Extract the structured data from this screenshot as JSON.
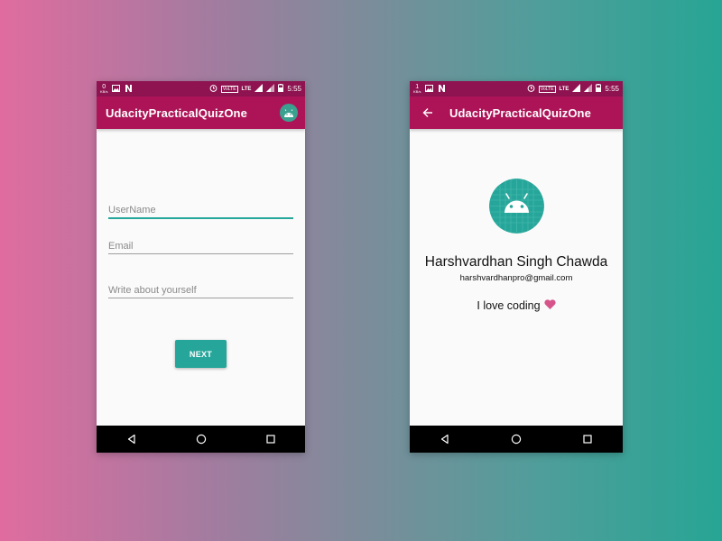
{
  "colors": {
    "primary": "#ad1457",
    "primary_dark": "#8e1350",
    "accent": "#26a69a",
    "heart": "#d6548a"
  },
  "screen1": {
    "status": {
      "kb_value": "0",
      "kb_unit": "KB/s",
      "volte": "VoLTE",
      "lte": "LTE",
      "time": "5:55"
    },
    "app_title": "UdacityPracticalQuizOne",
    "fields": {
      "username_placeholder": "UserName",
      "email_placeholder": "Email",
      "about_placeholder": "Write about yourself"
    },
    "next_label": "NEXT"
  },
  "screen2": {
    "status": {
      "kb_value": "1",
      "kb_unit": "KB/s",
      "volte": "VoLTE",
      "lte": "LTE",
      "time": "5:55"
    },
    "app_title": "UdacityPracticalQuizOne",
    "profile": {
      "name": "Harshvardhan Singh Chawda",
      "email": "harshvardhanpro@gmail.com",
      "bio": "I love coding"
    }
  },
  "icons": [
    "image-icon",
    "n-icon",
    "alarm-icon",
    "signal-icon",
    "battery-icon",
    "android-icon",
    "back-arrow-icon",
    "nav-back-icon",
    "nav-home-icon",
    "nav-recents-icon",
    "heart-icon"
  ]
}
